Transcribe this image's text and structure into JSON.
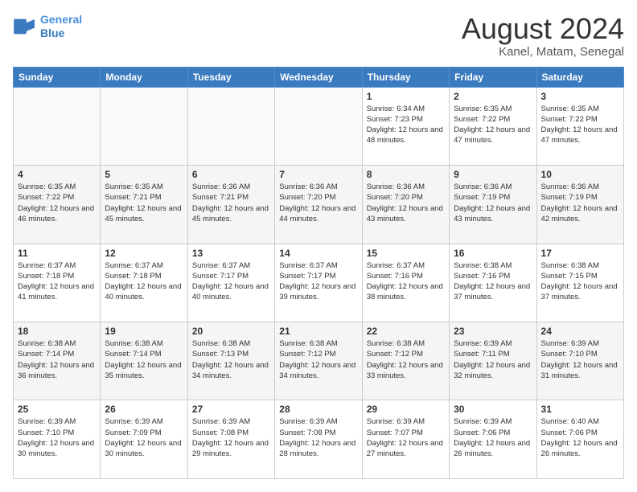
{
  "header": {
    "logo": {
      "line1": "General",
      "line2": "Blue"
    },
    "title": "August 2024",
    "subtitle": "Kanel, Matam, Senegal"
  },
  "days_of_week": [
    "Sunday",
    "Monday",
    "Tuesday",
    "Wednesday",
    "Thursday",
    "Friday",
    "Saturday"
  ],
  "weeks": [
    [
      {
        "day": "",
        "info": ""
      },
      {
        "day": "",
        "info": ""
      },
      {
        "day": "",
        "info": ""
      },
      {
        "day": "",
        "info": ""
      },
      {
        "day": "1",
        "info": "Sunrise: 6:34 AM\nSunset: 7:23 PM\nDaylight: 12 hours\nand 48 minutes."
      },
      {
        "day": "2",
        "info": "Sunrise: 6:35 AM\nSunset: 7:22 PM\nDaylight: 12 hours\nand 47 minutes."
      },
      {
        "day": "3",
        "info": "Sunrise: 6:35 AM\nSunset: 7:22 PM\nDaylight: 12 hours\nand 47 minutes."
      }
    ],
    [
      {
        "day": "4",
        "info": "Sunrise: 6:35 AM\nSunset: 7:22 PM\nDaylight: 12 hours\nand 46 minutes."
      },
      {
        "day": "5",
        "info": "Sunrise: 6:35 AM\nSunset: 7:21 PM\nDaylight: 12 hours\nand 45 minutes."
      },
      {
        "day": "6",
        "info": "Sunrise: 6:36 AM\nSunset: 7:21 PM\nDaylight: 12 hours\nand 45 minutes."
      },
      {
        "day": "7",
        "info": "Sunrise: 6:36 AM\nSunset: 7:20 PM\nDaylight: 12 hours\nand 44 minutes."
      },
      {
        "day": "8",
        "info": "Sunrise: 6:36 AM\nSunset: 7:20 PM\nDaylight: 12 hours\nand 43 minutes."
      },
      {
        "day": "9",
        "info": "Sunrise: 6:36 AM\nSunset: 7:19 PM\nDaylight: 12 hours\nand 43 minutes."
      },
      {
        "day": "10",
        "info": "Sunrise: 6:36 AM\nSunset: 7:19 PM\nDaylight: 12 hours\nand 42 minutes."
      }
    ],
    [
      {
        "day": "11",
        "info": "Sunrise: 6:37 AM\nSunset: 7:18 PM\nDaylight: 12 hours\nand 41 minutes."
      },
      {
        "day": "12",
        "info": "Sunrise: 6:37 AM\nSunset: 7:18 PM\nDaylight: 12 hours\nand 40 minutes."
      },
      {
        "day": "13",
        "info": "Sunrise: 6:37 AM\nSunset: 7:17 PM\nDaylight: 12 hours\nand 40 minutes."
      },
      {
        "day": "14",
        "info": "Sunrise: 6:37 AM\nSunset: 7:17 PM\nDaylight: 12 hours\nand 39 minutes."
      },
      {
        "day": "15",
        "info": "Sunrise: 6:37 AM\nSunset: 7:16 PM\nDaylight: 12 hours\nand 38 minutes."
      },
      {
        "day": "16",
        "info": "Sunrise: 6:38 AM\nSunset: 7:16 PM\nDaylight: 12 hours\nand 37 minutes."
      },
      {
        "day": "17",
        "info": "Sunrise: 6:38 AM\nSunset: 7:15 PM\nDaylight: 12 hours\nand 37 minutes."
      }
    ],
    [
      {
        "day": "18",
        "info": "Sunrise: 6:38 AM\nSunset: 7:14 PM\nDaylight: 12 hours\nand 36 minutes."
      },
      {
        "day": "19",
        "info": "Sunrise: 6:38 AM\nSunset: 7:14 PM\nDaylight: 12 hours\nand 35 minutes."
      },
      {
        "day": "20",
        "info": "Sunrise: 6:38 AM\nSunset: 7:13 PM\nDaylight: 12 hours\nand 34 minutes."
      },
      {
        "day": "21",
        "info": "Sunrise: 6:38 AM\nSunset: 7:12 PM\nDaylight: 12 hours\nand 34 minutes."
      },
      {
        "day": "22",
        "info": "Sunrise: 6:38 AM\nSunset: 7:12 PM\nDaylight: 12 hours\nand 33 minutes."
      },
      {
        "day": "23",
        "info": "Sunrise: 6:39 AM\nSunset: 7:11 PM\nDaylight: 12 hours\nand 32 minutes."
      },
      {
        "day": "24",
        "info": "Sunrise: 6:39 AM\nSunset: 7:10 PM\nDaylight: 12 hours\nand 31 minutes."
      }
    ],
    [
      {
        "day": "25",
        "info": "Sunrise: 6:39 AM\nSunset: 7:10 PM\nDaylight: 12 hours\nand 30 minutes."
      },
      {
        "day": "26",
        "info": "Sunrise: 6:39 AM\nSunset: 7:09 PM\nDaylight: 12 hours\nand 30 minutes."
      },
      {
        "day": "27",
        "info": "Sunrise: 6:39 AM\nSunset: 7:08 PM\nDaylight: 12 hours\nand 29 minutes."
      },
      {
        "day": "28",
        "info": "Sunrise: 6:39 AM\nSunset: 7:08 PM\nDaylight: 12 hours\nand 28 minutes."
      },
      {
        "day": "29",
        "info": "Sunrise: 6:39 AM\nSunset: 7:07 PM\nDaylight: 12 hours\nand 27 minutes."
      },
      {
        "day": "30",
        "info": "Sunrise: 6:39 AM\nSunset: 7:06 PM\nDaylight: 12 hours\nand 26 minutes."
      },
      {
        "day": "31",
        "info": "Sunrise: 6:40 AM\nSunset: 7:06 PM\nDaylight: 12 hours\nand 26 minutes."
      }
    ]
  ]
}
